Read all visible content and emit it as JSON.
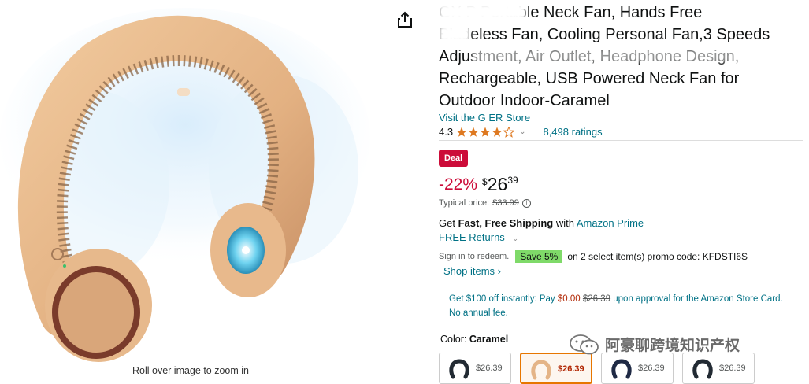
{
  "image": {
    "zoom_hint": "Roll over image to zoom in",
    "share_icon": "share-icon"
  },
  "product": {
    "title": "GX   P Portable Neck Fan, Hands Free\nBladeless Fan, Cooling Personal Fan,3 Speeds\nAdjustment, Air Outlet, Headphone Design,\nRechargeable, USB Powered Neck Fan for\nOutdoor Indoor-Caramel",
    "store_link": "Visit the G      ER Store",
    "rating_value": "4.3",
    "ratings_count": "8,498 ratings",
    "stars": 4.3
  },
  "pricing": {
    "deal_label": "Deal",
    "discount": "-22%",
    "currency": "$",
    "whole": "26",
    "fraction": "39",
    "typical_label": "Typical price:",
    "typical_price": "$33.99"
  },
  "shipping": {
    "get": "Get",
    "fast_free": "Fast, Free Shipping",
    "with": "with",
    "prime": "Amazon Prime",
    "returns": "FREE Returns"
  },
  "promo": {
    "signin": "Sign in to redeem.",
    "save": "Save 5%",
    "text": "on 2 select item(s) promo code: KFDSTI6S",
    "shop_items": "Shop items ›"
  },
  "card_offer": {
    "prefix": "Get $100 off instantly: Pay",
    "pay": "$0.00",
    "strike": "$26.39",
    "suffix": "upon approval for the Amazon Store Card. No annual fee."
  },
  "color": {
    "label": "Color:",
    "value": "Caramel",
    "swatches": [
      {
        "price": "$26.39",
        "color": "#222a33",
        "selected": false
      },
      {
        "price": "$26.39",
        "color": "#e4b487",
        "selected": true
      },
      {
        "price": "$26.39",
        "color": "#1f2a45",
        "selected": false
      },
      {
        "price": "$26.39",
        "color": "#222a33",
        "selected": false
      }
    ]
  },
  "watermark": {
    "text": "阿豪聊跨境知识产权"
  },
  "colors": {
    "link": "#007185",
    "deal": "#cc0c39",
    "save_badge": "#7fda69",
    "star": "#de7921",
    "caramel": "#e4b487"
  }
}
